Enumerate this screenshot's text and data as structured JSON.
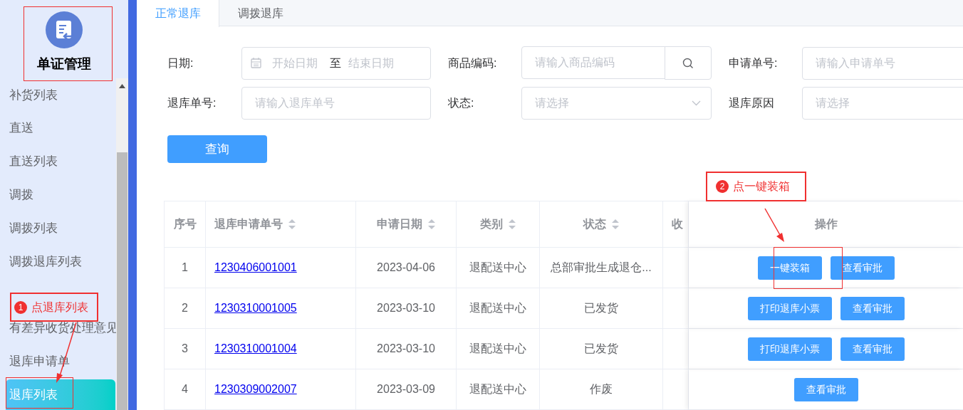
{
  "sidebar": {
    "title": "单证管理",
    "items": [
      {
        "label": "补货列表",
        "selected": false
      },
      {
        "label": "直送",
        "selected": false
      },
      {
        "label": "直送列表",
        "selected": false
      },
      {
        "label": "调拨",
        "selected": false
      },
      {
        "label": "调拨列表",
        "selected": false
      },
      {
        "label": "调拨退库列表",
        "selected": false
      },
      {
        "selected": false
      },
      {
        "label": "有差异收货处理意见",
        "selected": false
      },
      {
        "label": "退库申请单",
        "selected": false
      },
      {
        "label": "退库列表",
        "selected": true
      }
    ]
  },
  "tabs": [
    {
      "label": "正常退库",
      "selected": true
    },
    {
      "label": "调拨退库",
      "selected": false
    }
  ],
  "filters": [
    {
      "label": "日期:",
      "kind": "date-range",
      "start_placeholder": "开始日期",
      "separator": "至",
      "end_placeholder": "结束日期"
    },
    {
      "label": "商品编码:",
      "kind": "search",
      "placeholder": "请输入商品编码"
    },
    {
      "label": "申请单号:",
      "kind": "text",
      "placeholder": "请输入申请单号"
    },
    {
      "label": "退库单号:",
      "kind": "text",
      "placeholder": "请输入退库单号"
    },
    {
      "label": "状态:",
      "kind": "select",
      "placeholder": "请选择"
    },
    {
      "label": "退库原因",
      "kind": "text",
      "placeholder": "请选择"
    }
  ],
  "query_button": "查询",
  "table": {
    "columns": [
      {
        "label": "序号",
        "sortable": false
      },
      {
        "label": "退库申请单号",
        "sortable": true
      },
      {
        "label": "申请日期",
        "sortable": true
      },
      {
        "label": "类别",
        "sortable": true
      },
      {
        "label": "状态",
        "sortable": true
      },
      {
        "label": "收",
        "sortable": false
      },
      {
        "label": "操作",
        "sortable": false
      }
    ],
    "rows": [
      {
        "index": "1",
        "number": "1230406001001",
        "date": "2023-04-06",
        "category": "退配送中心",
        "status": "总部审批生成退仓...",
        "actions": [
          "一键装箱",
          "查看审批"
        ]
      },
      {
        "index": "2",
        "number": "1230310001005",
        "date": "2023-03-10",
        "category": "退配送中心",
        "status": "已发货",
        "actions": [
          "打印退库小票",
          "查看审批"
        ]
      },
      {
        "index": "3",
        "number": "1230310001004",
        "date": "2023-03-10",
        "category": "退配送中心",
        "status": "已发货",
        "actions": [
          "打印退库小票",
          "查看审批"
        ]
      },
      {
        "index": "4",
        "number": "1230309002007",
        "date": "2023-03-09",
        "category": "退配送中心",
        "status": "作废",
        "actions": [
          "查看审批"
        ]
      }
    ]
  },
  "annotations": [
    {
      "number": "1",
      "text": "点退库列表"
    },
    {
      "number": "2",
      "text": "点一键装箱"
    }
  ]
}
